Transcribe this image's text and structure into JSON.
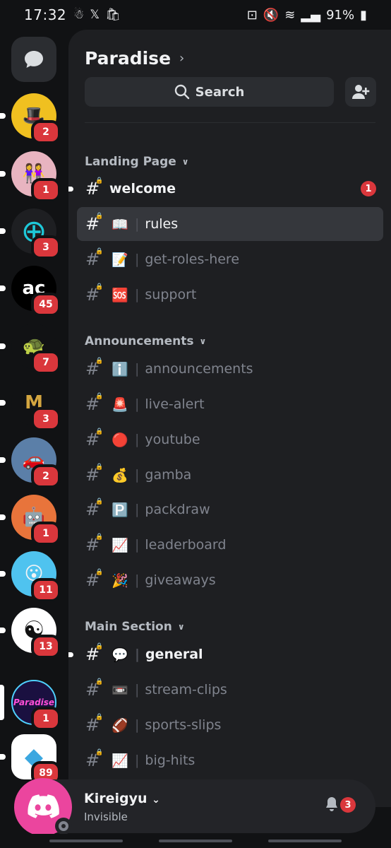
{
  "status": {
    "time": "17:32",
    "battery": "91%"
  },
  "rail": {
    "servers": [
      {
        "name": "server-1",
        "badge": "2",
        "bg": "#f0c020",
        "glyph": "🎩"
      },
      {
        "name": "server-2",
        "badge": "1",
        "bg": "#e8b4c0",
        "glyph": "👭"
      },
      {
        "name": "server-3",
        "badge": "3",
        "bg": "#1e1f22",
        "glyph": "⊕"
      },
      {
        "name": "server-4",
        "badge": "45",
        "bg": "#000000",
        "glyph": "ac"
      },
      {
        "name": "server-5",
        "badge": "7",
        "bg": "#111214",
        "glyph": "🐢"
      },
      {
        "name": "server-6",
        "badge": "3",
        "bg": "#111214",
        "glyph": "M"
      },
      {
        "name": "server-7",
        "badge": "2",
        "bg": "#5b7fa8",
        "glyph": "🚗"
      },
      {
        "name": "server-8",
        "badge": "1",
        "bg": "#e8743b",
        "glyph": "🤖"
      },
      {
        "name": "server-9",
        "badge": "11",
        "bg": "#4fc3ef",
        "glyph": "😮"
      },
      {
        "name": "server-10",
        "badge": "13",
        "bg": "#ffffff",
        "glyph": "☯"
      },
      {
        "name": "server-paradise",
        "badge": "1",
        "bg": "#1a1040",
        "glyph": "Paradise"
      },
      {
        "name": "server-12",
        "badge": "89",
        "bg": "#ffffff",
        "glyph": "◆"
      }
    ]
  },
  "server": {
    "title": "Paradise",
    "search_label": "Search"
  },
  "categories": [
    {
      "label": "Landing Page",
      "channels": [
        {
          "name": "welcome",
          "emoji": "",
          "state": "unread",
          "badge": "1"
        },
        {
          "name": "rules",
          "emoji": "📖",
          "state": "selected",
          "badge": ""
        },
        {
          "name": "get-roles-here",
          "emoji": "📝",
          "state": "muted",
          "badge": ""
        },
        {
          "name": "support",
          "emoji": "🆘",
          "state": "muted",
          "badge": ""
        }
      ]
    },
    {
      "label": "Announcements",
      "channels": [
        {
          "name": "announcements",
          "emoji": "ℹ️",
          "state": "muted",
          "badge": ""
        },
        {
          "name": "live-alert",
          "emoji": "🚨",
          "state": "muted",
          "badge": ""
        },
        {
          "name": "youtube",
          "emoji": "🔴",
          "state": "muted",
          "badge": ""
        },
        {
          "name": "gamba",
          "emoji": "💰",
          "state": "muted",
          "badge": ""
        },
        {
          "name": "packdraw",
          "emoji": "🅿️",
          "state": "muted",
          "badge": ""
        },
        {
          "name": "leaderboard",
          "emoji": "📈",
          "state": "muted",
          "badge": ""
        },
        {
          "name": "giveaways",
          "emoji": "🎉",
          "state": "muted",
          "badge": ""
        }
      ]
    },
    {
      "label": "Main Section",
      "channels": [
        {
          "name": "general",
          "emoji": "💬",
          "state": "unread",
          "badge": ""
        },
        {
          "name": "stream-clips",
          "emoji": "📼",
          "state": "muted",
          "badge": ""
        },
        {
          "name": "sports-slips",
          "emoji": "🏈",
          "state": "muted",
          "badge": ""
        },
        {
          "name": "big-hits",
          "emoji": "📈",
          "state": "muted",
          "badge": ""
        }
      ]
    }
  ],
  "user": {
    "name": "Kireigyu",
    "status": "Invisible",
    "notif_badge": "3"
  }
}
